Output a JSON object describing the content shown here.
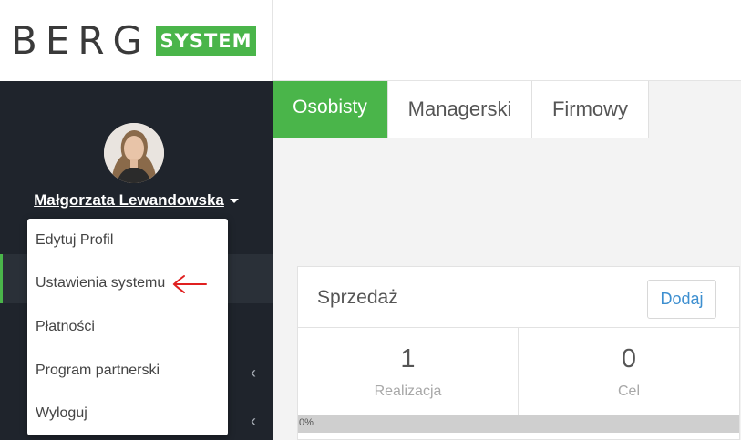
{
  "brand": {
    "word": "BERG",
    "badge": "SYSTEM",
    "badge_color": "#4ab54a"
  },
  "user": {
    "name": "Małgorzata Lewandowska"
  },
  "user_menu": {
    "items": [
      {
        "label": "Edytuj Profil"
      },
      {
        "label": "Ustawienia systemu"
      },
      {
        "label": "Płatności"
      },
      {
        "label": "Program partnerski"
      },
      {
        "label": "Wyloguj"
      }
    ],
    "highlighted": "Ustawienia systemu",
    "arrow_color": "#e02020"
  },
  "tabs": [
    {
      "label": "Osobisty",
      "active": true
    },
    {
      "label": "Managerski",
      "active": false
    },
    {
      "label": "Firmowy",
      "active": false
    }
  ],
  "sales_card": {
    "title": "Sprzedaż",
    "add_label": "Dodaj",
    "stats": [
      {
        "value": "1",
        "label": "Realizacja"
      },
      {
        "value": "0",
        "label": "Cel"
      }
    ],
    "progress_text": "0%",
    "progress_value": 0
  },
  "icons": {
    "user_caret": "chevron-down-icon",
    "sidebar_expand": "chevron-left-icon",
    "menu_pointer": "arrow-left-icon"
  },
  "colors": {
    "sidebar_bg": "#1f242c",
    "accent": "#4ab54a",
    "link_blue": "#3d8fd0"
  }
}
